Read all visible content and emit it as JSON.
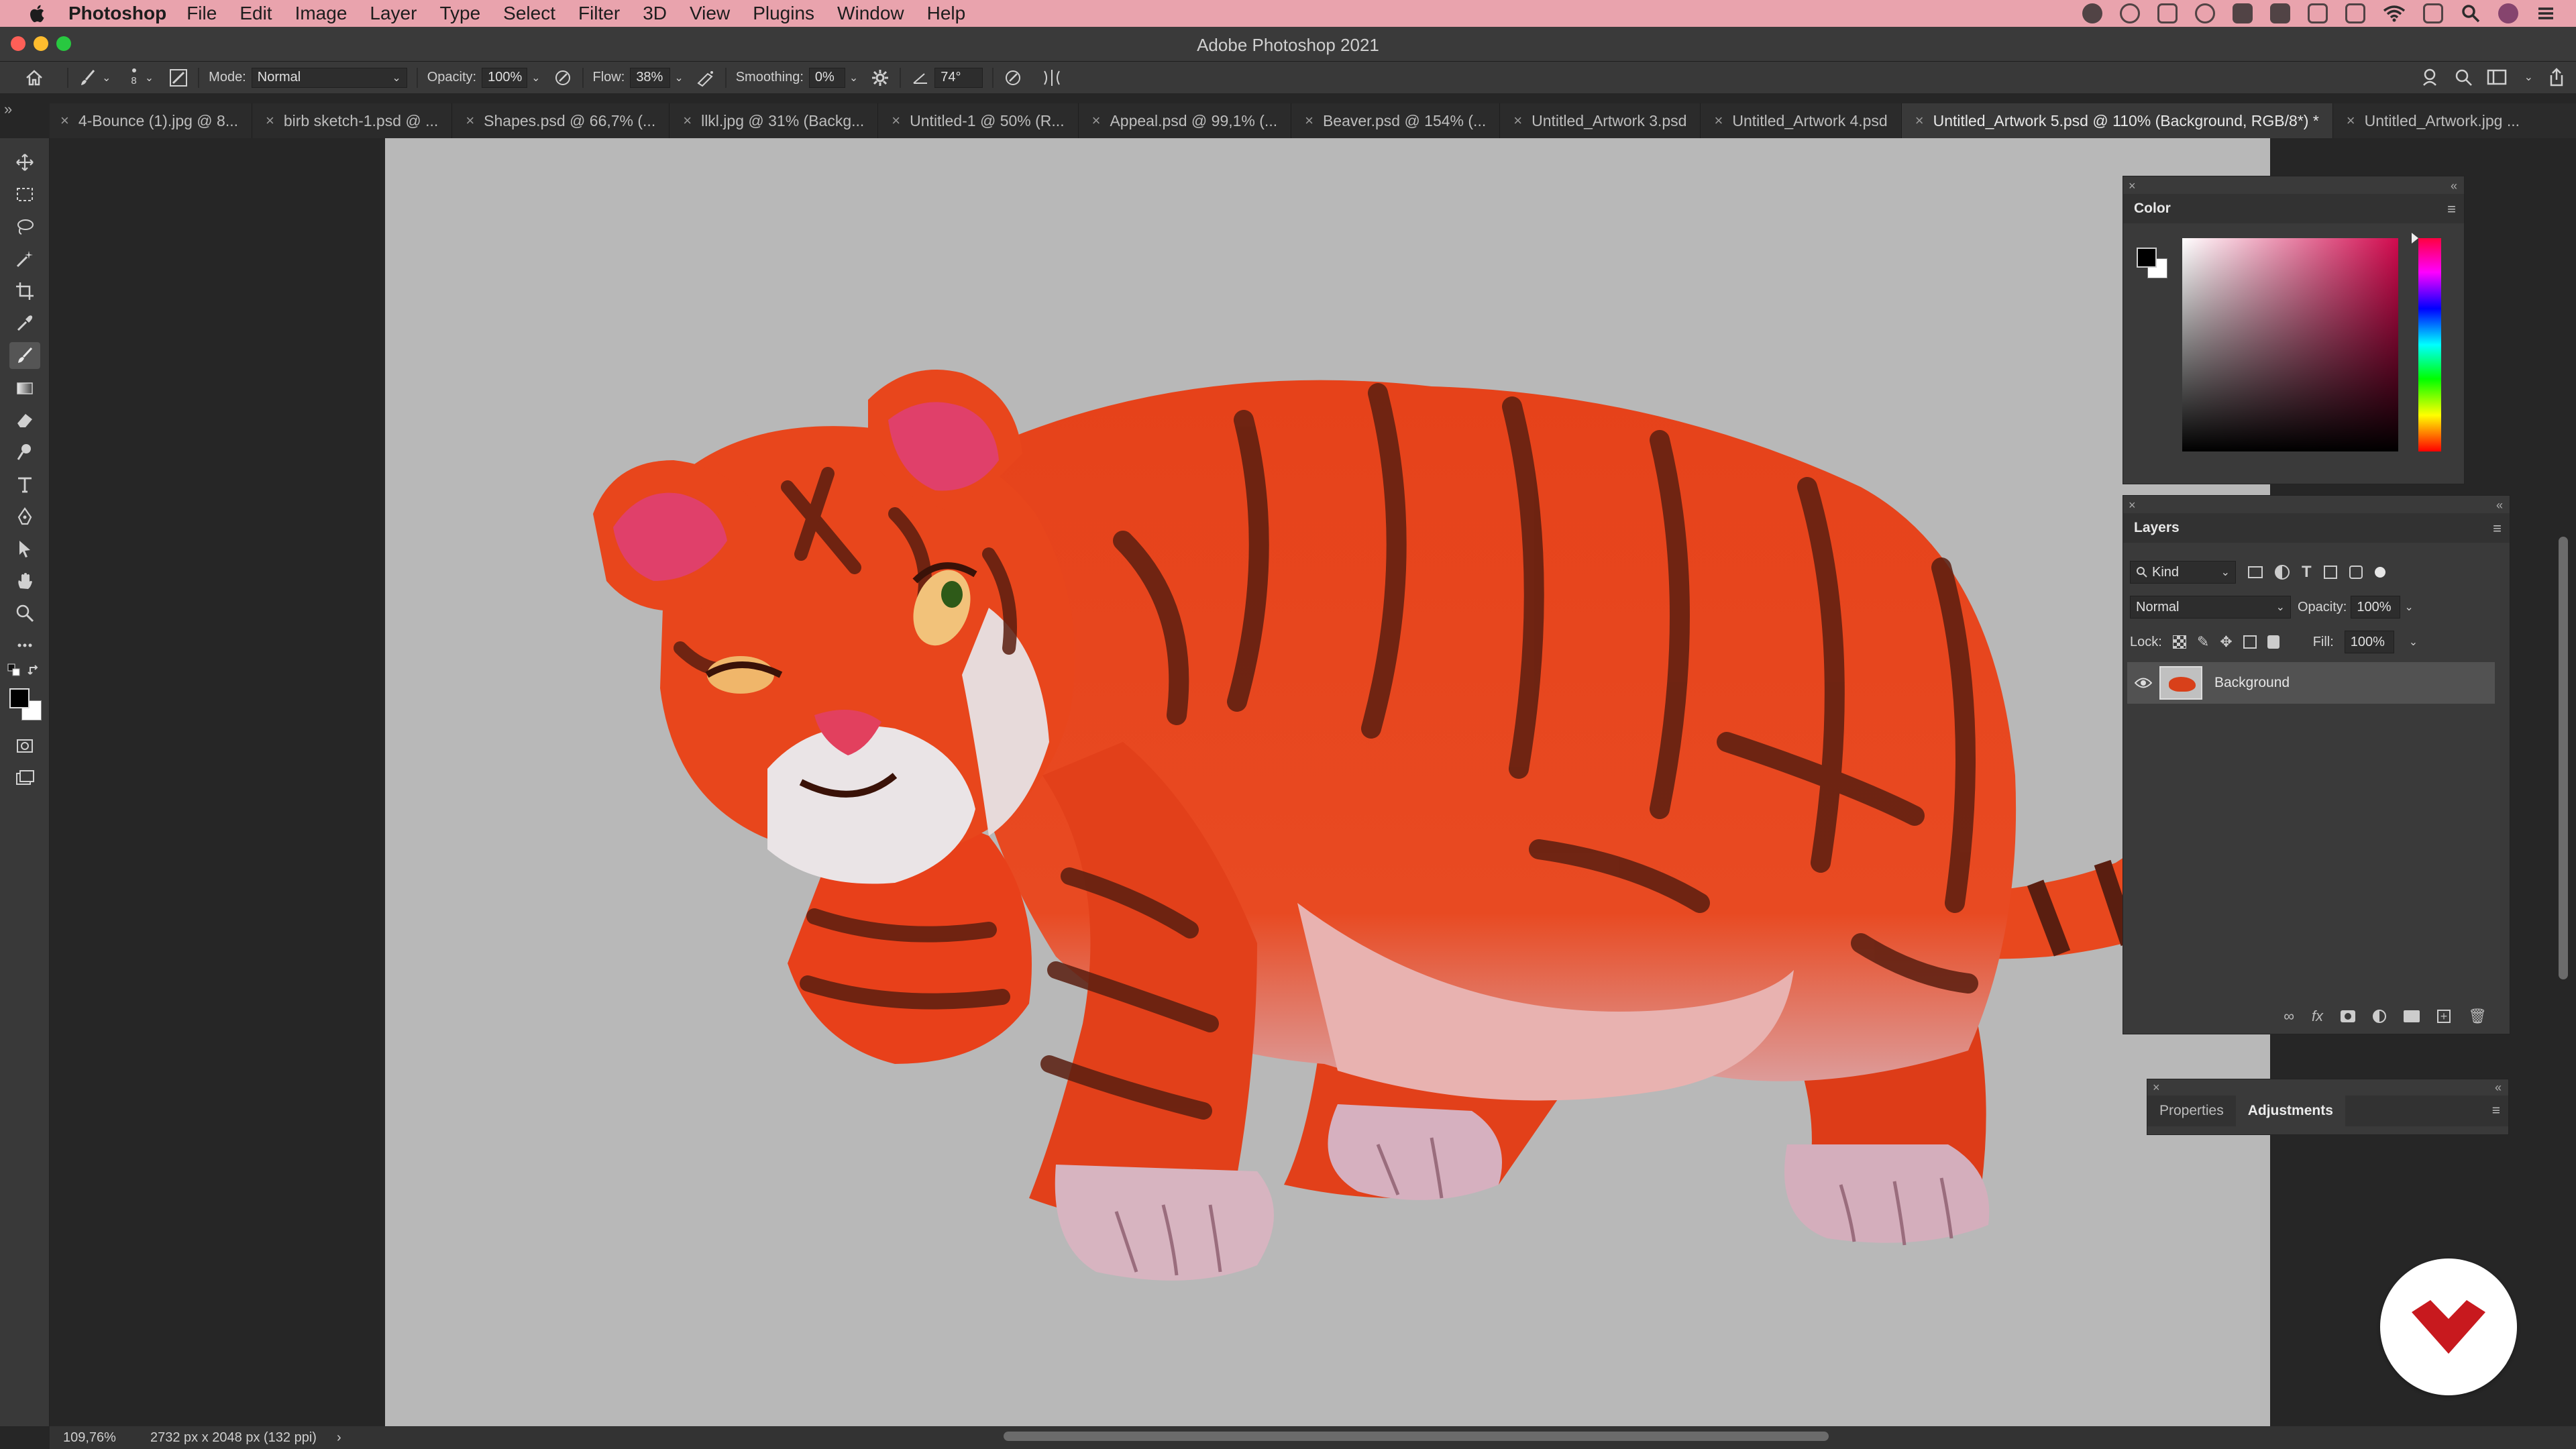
{
  "menubar": {
    "app_name": "Photoshop",
    "items": [
      "File",
      "Edit",
      "Image",
      "Layer",
      "Type",
      "Select",
      "Filter",
      "3D",
      "View",
      "Plugins",
      "Window",
      "Help"
    ]
  },
  "window": {
    "title": "Adobe Photoshop 2021"
  },
  "options_bar": {
    "brush_size": "8",
    "mode_label": "Mode:",
    "mode_value": "Normal",
    "opacity_label": "Opacity:",
    "opacity_value": "100%",
    "flow_label": "Flow:",
    "flow_value": "38%",
    "smoothing_label": "Smoothing:",
    "smoothing_value": "0%",
    "angle_value": "74°"
  },
  "tabs": [
    {
      "label": "4-Bounce (1).jpg @ 8..."
    },
    {
      "label": "birb sketch-1.psd @ ..."
    },
    {
      "label": "Shapes.psd @ 66,7% (..."
    },
    {
      "label": "llkl.jpg @ 31% (Backg..."
    },
    {
      "label": "Untitled-1 @ 50% (R..."
    },
    {
      "label": "Appeal.psd @ 99,1% (..."
    },
    {
      "label": "Beaver.psd @ 154% (..."
    },
    {
      "label": "Untitled_Artwork 3.psd"
    },
    {
      "label": "Untitled_Artwork 4.psd"
    },
    {
      "label": "Untitled_Artwork 5.psd @ 110% (Background, RGB/8*) *"
    },
    {
      "label": "Untitled_Artwork.jpg ..."
    }
  ],
  "color_panel": {
    "title": "Color"
  },
  "layers_panel": {
    "title": "Layers",
    "filter_kind": "Kind",
    "blend_mode": "Normal",
    "opacity_label": "Opacity:",
    "opacity_value": "100%",
    "lock_label": "Lock:",
    "fill_label": "Fill:",
    "fill_value": "100%",
    "layers": [
      {
        "name": "Background",
        "visible": true
      }
    ]
  },
  "props_panel": {
    "tab1": "Properties",
    "tab2": "Adjustments"
  },
  "status": {
    "zoom": "109,76%",
    "dimensions": "2732 px x 2048 px (132 ppi)",
    "arrow": "›"
  },
  "colors": {
    "menubar_bg": "#e9a3ad",
    "ui_dark": "#262626",
    "panel_bg": "#3a3a3a",
    "canvas_bg": "#b8b8b8",
    "tiger_orange": "#e8401a",
    "tiger_stripe": "#5a1e10",
    "brand_red": "#c8191e"
  },
  "icons": [
    "apple-icon",
    "home-icon",
    "brush-icon",
    "eye-icon",
    "brand-logo-icon"
  ]
}
